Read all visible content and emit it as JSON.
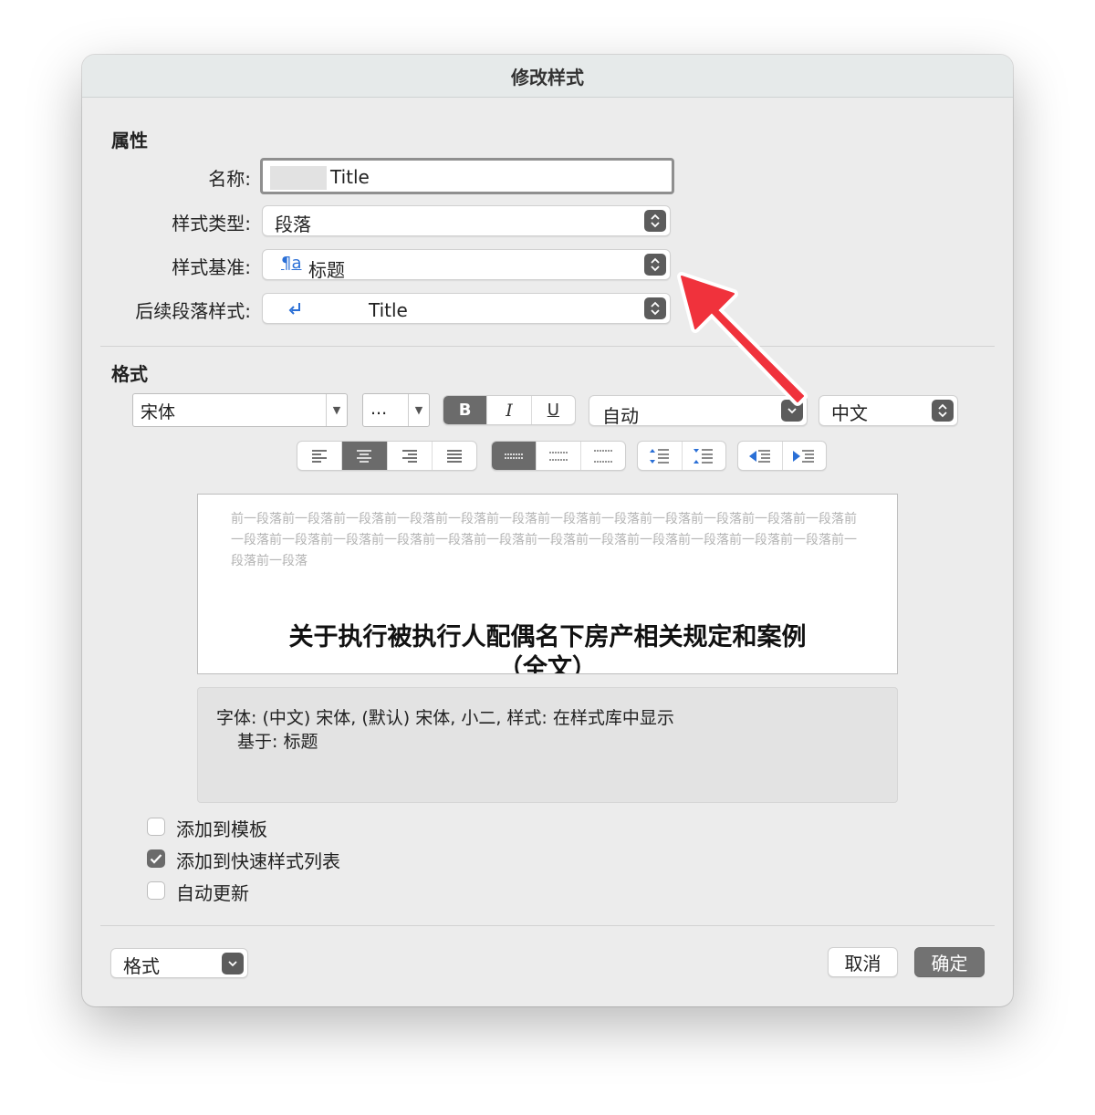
{
  "dialog": {
    "title": "修改样式"
  },
  "properties": {
    "heading": "属性",
    "name_label": "名称:",
    "name_value": "Title",
    "style_type_label": "样式类型:",
    "style_type_value": "段落",
    "based_on_label": "样式基准:",
    "based_on_icon": "paragraph-style-icon",
    "based_on_icon_text": "¶a",
    "based_on_value": "标题",
    "next_style_label": "后续段落样式:",
    "next_style_icon": "return-arrow-icon",
    "next_style_value": "Title"
  },
  "format": {
    "heading": "格式",
    "font_name": "宋体",
    "font_size": "...",
    "bold": "B",
    "italic": "I",
    "underline": "U",
    "color_value": "自动",
    "script_value": "中文",
    "alignment_buttons": [
      "align-left-icon",
      "align-center-icon",
      "align-right-icon",
      "align-justify-icon"
    ],
    "spacing_buttons": [
      "line-spacing-single-icon",
      "line-spacing-1-5-icon",
      "line-spacing-double-icon"
    ],
    "paragraph_spacing_buttons": [
      "increase-paragraph-spacing-icon",
      "decrease-paragraph-spacing-icon"
    ],
    "indent_buttons": [
      "decrease-indent-icon",
      "increase-indent-icon"
    ]
  },
  "preview": {
    "prev_paragraph": "前一段落前一段落前一段落前一段落前一段落前一段落前一段落前一段落前一段落前一段落前一段落前一段落前一段落前一段落前一段落前一段落前一段落前一段落前一段落前一段落前一段落前一段落前一段落前一段落前一段落前一段落",
    "title_line1": "关于执行被执行人配偶名下房产相关规定和案例",
    "title_line2": "（全文）"
  },
  "description": {
    "line1": "字体: (中文) 宋体, (默认) 宋体, 小二, 样式: 在样式库中显示",
    "line2": "基于: 标题"
  },
  "options": [
    {
      "label": "添加到模板",
      "checked": false
    },
    {
      "label": "添加到快速样式列表",
      "checked": true
    },
    {
      "label": "自动更新",
      "checked": false
    }
  ],
  "footer": {
    "format_menu": "格式",
    "cancel": "取消",
    "ok": "确定"
  },
  "annotation": {
    "arrow_color": "#f0323c"
  }
}
